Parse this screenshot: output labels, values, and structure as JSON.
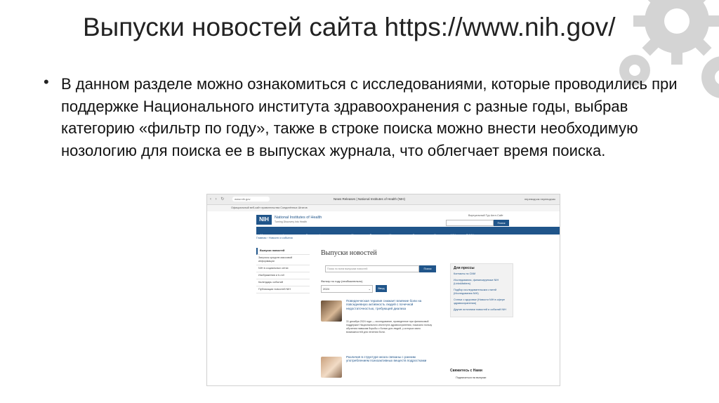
{
  "slide": {
    "title": "Выпуски новостей сайта https://www.nih.gov/",
    "bullet_text": "В данном разделе можно ознакомиться с исследованиями, которые проводились при поддержке Национального института здравоохранения с разные годы, выбрав категорию «фильтр по году», также в строке поиска можно внести необходимую нозологию для поиска ее в выпусках журнала, что облегчает время поиска."
  },
  "screenshot": {
    "browser": {
      "url": "www.nih.gov",
      "tab_title": "News Releases | National Institutes of Health (NIH)",
      "right_items": "переводчик   переводчик"
    },
    "gov_banner": "Официальный веб-сайт правительства Соединённых Штатов",
    "header": {
      "logo": "NIH",
      "logo_text": "National Institutes of Health",
      "logo_sub": "Turning Discovery Into Health",
      "top_links": "Виртуальный Тур   Англ.Сайт",
      "search_button": "Поиск"
    },
    "nav": [
      "Медицинская информация ⌄",
      "Гранты и финансирование ⌄",
      "Новости и события ⌄",
      "Исследования и обучение ⌄",
      "Институты в NIH ⌄",
      "О NIH ⌄"
    ],
    "breadcrumb": "Главная › Новости и события",
    "sidebar": [
      "Выпуски новостей",
      "Запросы средств массовой информации",
      "NIH в социальных сетях",
      "Изображения и b-roll",
      "Календарь событий",
      "Публикации новостей NIH"
    ],
    "page_heading": "Выпуски новостей",
    "search_placeholder": "Поиск по всем выпускам новостей",
    "search_button": "Поиск",
    "filter_label": "Фильтр по году (необязательно)",
    "filter_value": "2024",
    "filter_button": "Ввод",
    "news": [
      {
        "title": "Поведенческая терапия снижает влияние боли на повседневную активность людей с почечной недостаточностью, требующей диализа",
        "body": "31 декабря 2024 года — исследование, проведенное при финансовой поддержке Национального института здравоохранения, показало пользу обучения навыкам борьбы с болью для людей, у которых мало возможностей для лечения боли."
      },
      {
        "title": "Различия в структуре мозга связаны с ранним употреблением психоактивных веществ подростками",
        "body": ""
      }
    ],
    "press": {
      "title": "Для прессы",
      "links": [
        "Контакты по СМИ",
        "Исследования, финансируемые NIH (LinksMatters)",
        "Подбор исследовательских статей (Исследования NIH)",
        "Статьи о здоровье (Новости NIH в сфере здравоохранения)",
        "Другие источники новостей и событий NIH"
      ]
    },
    "connect": {
      "title": "Свяжитесь с Нами",
      "subscribe": "Подписаться на выпуски"
    }
  }
}
